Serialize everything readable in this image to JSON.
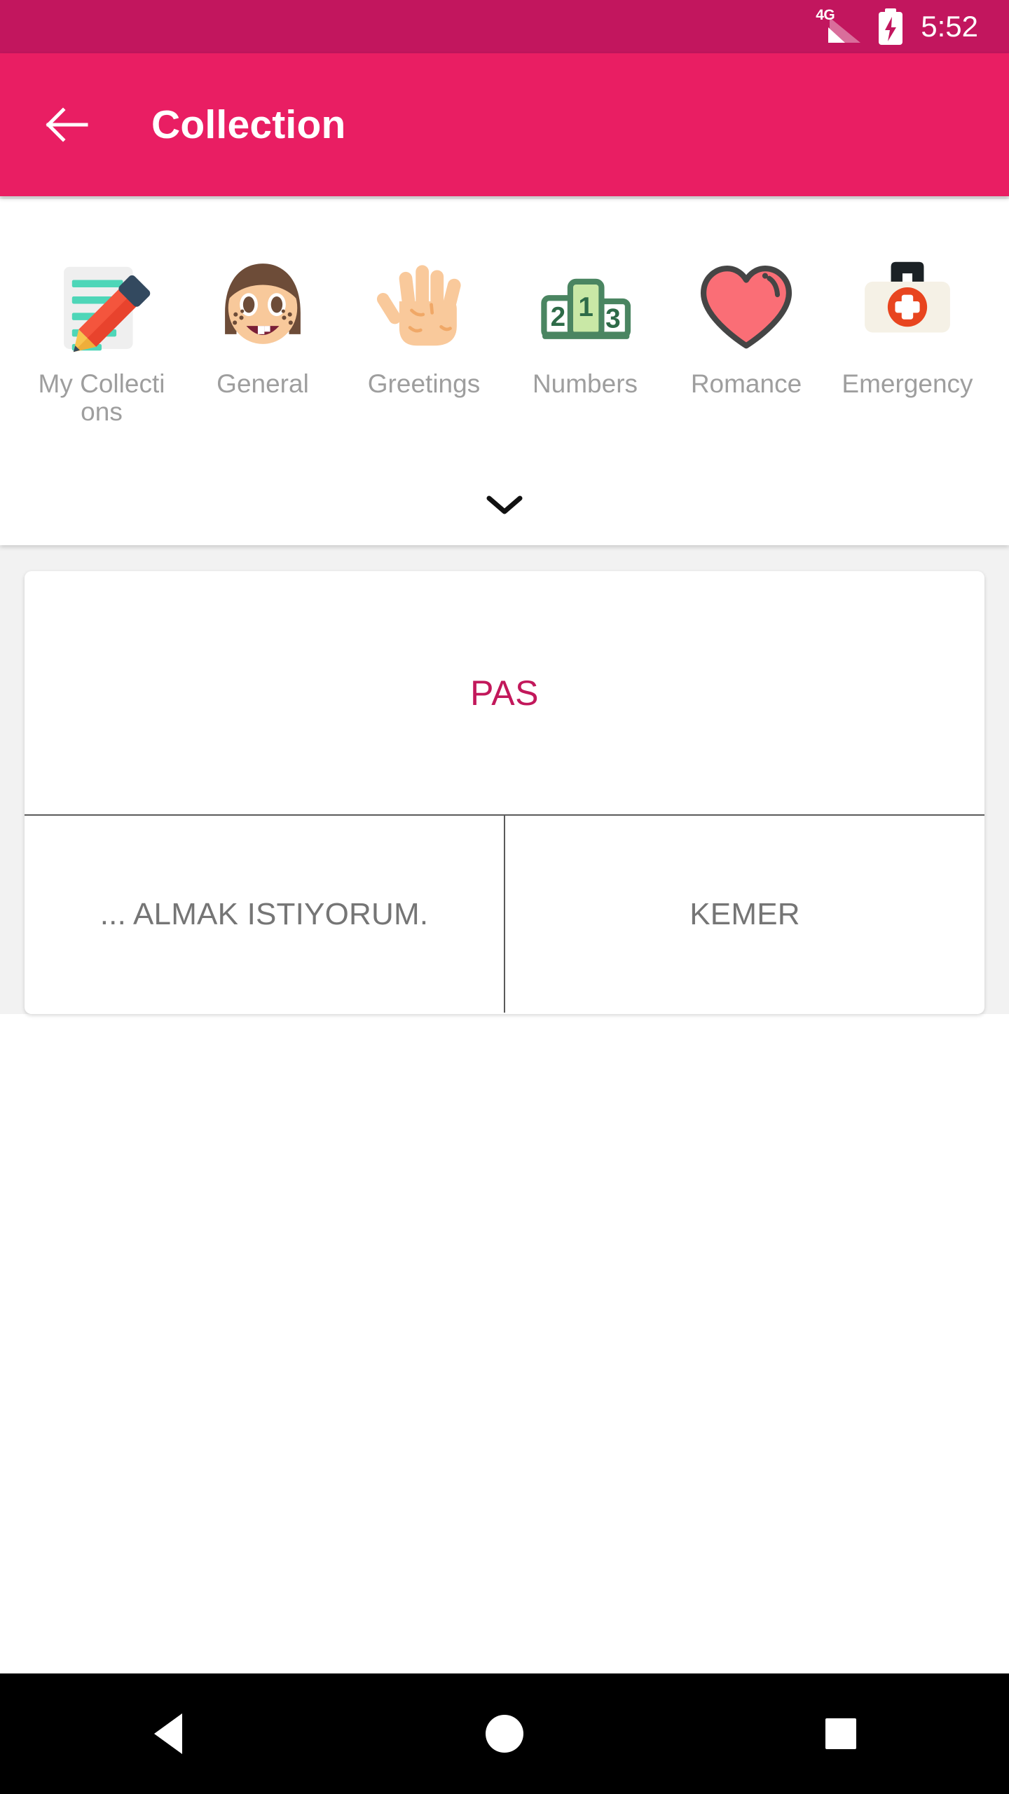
{
  "status_bar": {
    "network_label": "4G",
    "network_icon": "signal-4g-icon",
    "battery_icon": "battery-charging-icon",
    "time": "5:52",
    "background_color": "#C2165E"
  },
  "app_bar": {
    "back_icon": "arrow-left-icon",
    "title": "Collection",
    "background_color": "#E91E63",
    "text_color": "#FFFFFF"
  },
  "categories": {
    "expand_icon": "chevron-down-icon",
    "items": [
      {
        "label": "My Collections",
        "icon": "memo-pencil-icon"
      },
      {
        "label": "General",
        "icon": "girl-face-icon"
      },
      {
        "label": "Greetings",
        "icon": "raised-hand-icon"
      },
      {
        "label": "Numbers",
        "icon": "podium-ranking-icon"
      },
      {
        "label": "Romance",
        "icon": "heart-icon"
      },
      {
        "label": "Emergency",
        "icon": "first-aid-kit-icon"
      }
    ]
  },
  "phrase_card": {
    "headline": "PAS",
    "headline_color": "#C2185B",
    "options": [
      "... ALMAK ISTIYORUM.",
      "KEMER"
    ],
    "option_color": "#757575"
  },
  "nav_bar": {
    "back_icon": "nav-back-triangle-icon",
    "home_icon": "nav-home-circle-icon",
    "recents_icon": "nav-recents-square-icon",
    "background_color": "#000000"
  }
}
